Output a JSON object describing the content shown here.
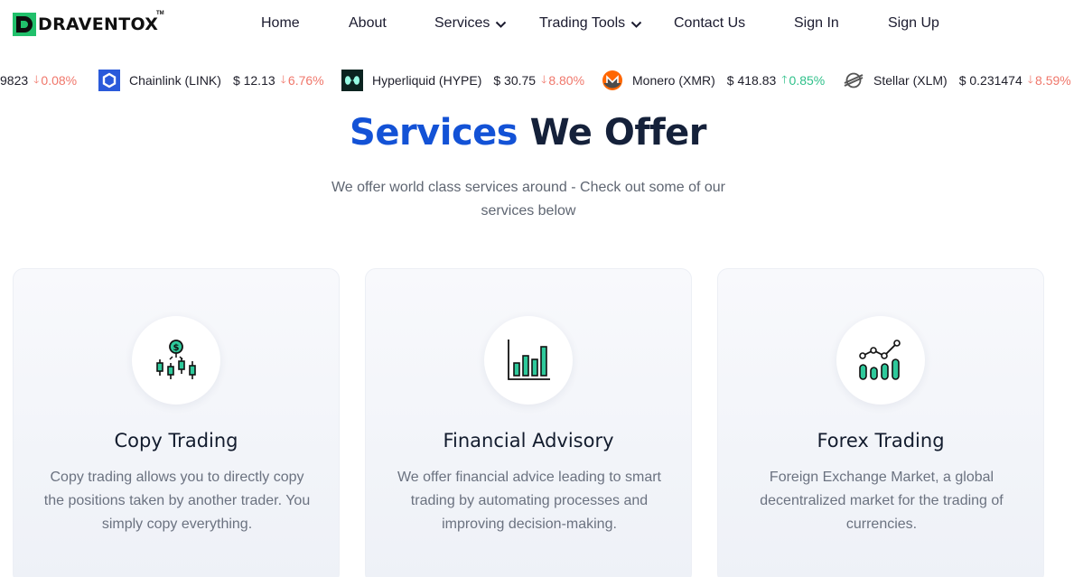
{
  "brand": {
    "name": "DRAVENTOX",
    "tm": "TM"
  },
  "nav": {
    "home": "Home",
    "about": "About",
    "services": "Services",
    "trading_tools": "Trading Tools",
    "contact": "Contact Us",
    "signin": "Sign In",
    "signup": "Sign Up"
  },
  "ticker": [
    {
      "name": "",
      "price": "9823",
      "change": "0.08%",
      "direction": "down"
    },
    {
      "name": "Chainlink (LINK)",
      "price": "$ 12.13",
      "change": "6.76%",
      "direction": "down",
      "icon": "chainlink-icon"
    },
    {
      "name": "Hyperliquid (HYPE)",
      "price": "$ 30.75",
      "change": "8.80%",
      "direction": "down",
      "icon": "hyperliquid-icon"
    },
    {
      "name": "Monero (XMR)",
      "price": "$ 418.83",
      "change": "0.85%",
      "direction": "up",
      "icon": "monero-icon"
    },
    {
      "name": "Stellar (XLM)",
      "price": "$ 0.231474",
      "change": "8.59%",
      "direction": "down",
      "icon": "stellar-icon"
    }
  ],
  "heading": {
    "accent": "Services",
    "rest": "We Offer"
  },
  "subtitle": "We offer world class services around - Check out some of our services below",
  "cards": [
    {
      "title": "Copy Trading",
      "desc": "Copy trading allows you to directly copy the positions taken by another trader. You simply copy everything.",
      "icon": "candlestick-dollar-icon"
    },
    {
      "title": "Financial Advisory",
      "desc": "We offer financial advice leading to smart trading by automating processes and improving decision-making.",
      "icon": "bar-chart-icon"
    },
    {
      "title": "Forex Trading",
      "desc": "Foreign Exchange Market, a global decentralized market for the trading of currencies.",
      "icon": "growth-chart-icon"
    }
  ],
  "colors": {
    "accent": "#1352d6",
    "teal": "#2ec99b",
    "down": "#f0776b",
    "up": "#2fc08a",
    "logo_green": "#21c06b"
  }
}
